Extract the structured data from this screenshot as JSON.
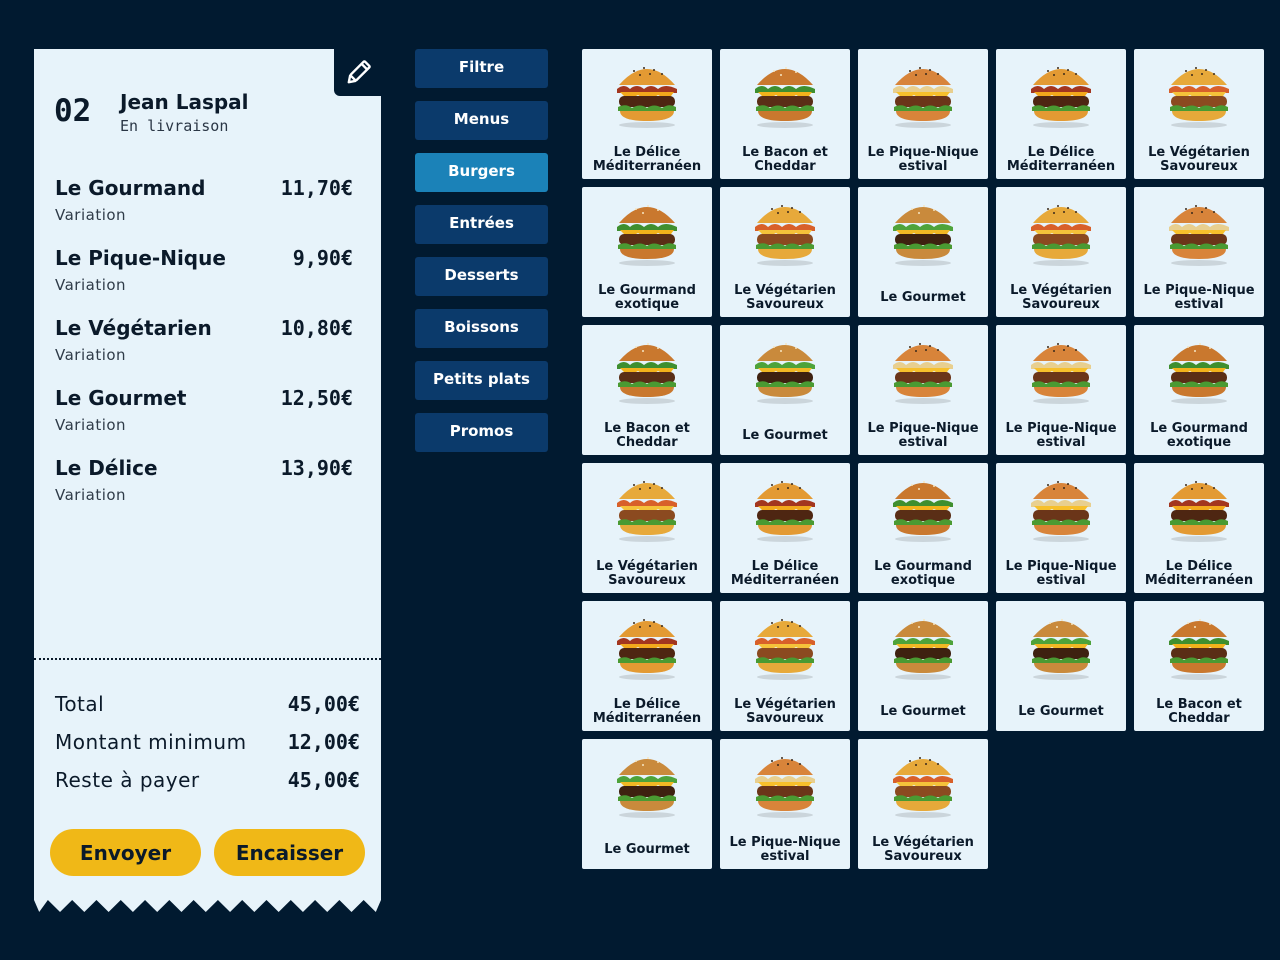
{
  "order": {
    "number": "02",
    "customer_name": "Jean Laspal",
    "status": "En livraison",
    "lines": [
      {
        "name": "Le Gourmand",
        "price": "11,70€",
        "variation": "Variation"
      },
      {
        "name": "Le Pique-Nique",
        "price": "9,90€",
        "variation": "Variation"
      },
      {
        "name": "Le Végétarien",
        "price": "10,80€",
        "variation": "Variation"
      },
      {
        "name": "Le Gourmet",
        "price": "12,50€",
        "variation": "Variation"
      },
      {
        "name": "Le Délice",
        "price": "13,90€",
        "variation": "Variation"
      }
    ],
    "totals": [
      {
        "label": "Total",
        "value": "45,00€"
      },
      {
        "label": "Montant minimum",
        "value": "12,00€"
      },
      {
        "label": "Reste à payer",
        "value": "45,00€"
      }
    ],
    "send_label": "Envoyer",
    "cash_label": "Encaisser",
    "edit_icon": "pencil-icon"
  },
  "categories": [
    {
      "label": "Filtre",
      "active": false
    },
    {
      "label": "Menus",
      "active": false
    },
    {
      "label": "Burgers",
      "active": true
    },
    {
      "label": "Entrées",
      "active": false
    },
    {
      "label": "Desserts",
      "active": false
    },
    {
      "label": "Boissons",
      "active": false
    },
    {
      "label": "Petits plats",
      "active": false
    },
    {
      "label": "Promos",
      "active": false
    }
  ],
  "products": [
    {
      "name": "Le Délice Méditerranéen",
      "image": "burger-bacon-tall"
    },
    {
      "name": "Le Bacon et Cheddar",
      "image": "burger-classic"
    },
    {
      "name": "Le Pique-Nique estival",
      "image": "burger-cheesy"
    },
    {
      "name": "Le Délice Méditerranéen",
      "image": "burger-bacon-tall"
    },
    {
      "name": "Le Végétarien Savoureux",
      "image": "burger-veggie"
    },
    {
      "name": "Le Gourmand exotique",
      "image": "burger-classic"
    },
    {
      "name": "Le Végétarien Savoureux",
      "image": "burger-veggie"
    },
    {
      "name": "Le Gourmet",
      "image": "burger-gourmet"
    },
    {
      "name": "Le Végétarien Savoureux",
      "image": "burger-veggie"
    },
    {
      "name": "Le Pique-Nique estival",
      "image": "burger-cheesy"
    },
    {
      "name": "Le Bacon et Cheddar",
      "image": "burger-classic"
    },
    {
      "name": "Le Gourmet",
      "image": "burger-gourmet"
    },
    {
      "name": "Le Pique-Nique estival",
      "image": "burger-cheesy"
    },
    {
      "name": "Le Pique-Nique estival",
      "image": "burger-cheesy"
    },
    {
      "name": "Le Gourmand exotique",
      "image": "burger-classic"
    },
    {
      "name": "Le Végétarien Savoureux",
      "image": "burger-veggie"
    },
    {
      "name": "Le Délice Méditerranéen",
      "image": "burger-bacon-tall"
    },
    {
      "name": "Le Gourmand exotique",
      "image": "burger-classic"
    },
    {
      "name": "Le Pique-Nique estival",
      "image": "burger-cheesy"
    },
    {
      "name": "Le Délice Méditerranéen",
      "image": "burger-bacon-tall"
    },
    {
      "name": "Le Délice Méditerranéen",
      "image": "burger-bacon-tall"
    },
    {
      "name": "Le Végétarien Savoureux",
      "image": "burger-veggie"
    },
    {
      "name": "Le Gourmet",
      "image": "burger-gourmet"
    },
    {
      "name": "Le Gourmet",
      "image": "burger-gourmet"
    },
    {
      "name": "Le Bacon et Cheddar",
      "image": "burger-classic"
    },
    {
      "name": "Le Gourmet",
      "image": "burger-gourmet"
    },
    {
      "name": "Le Pique-Nique estival",
      "image": "burger-cheesy"
    },
    {
      "name": "Le Végétarien Savoureux",
      "image": "burger-veggie"
    }
  ],
  "colors": {
    "background": "#011a30",
    "panel": "#e7f3fa",
    "category": "#0b3a6b",
    "category_active": "#1b82b8",
    "action": "#f0b817"
  }
}
